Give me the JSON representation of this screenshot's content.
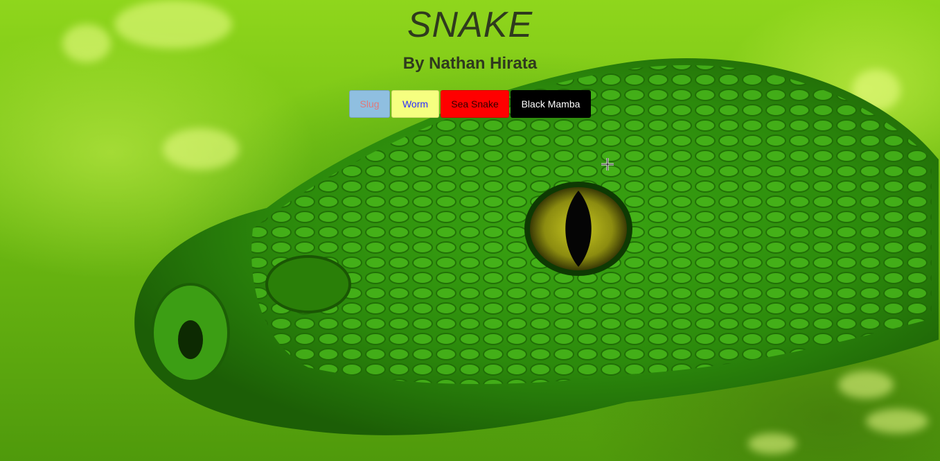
{
  "header": {
    "title": "SNAKE",
    "subtitle": "By Nathan Hirata"
  },
  "buttons": [
    {
      "label": "Slug",
      "bg": "#8fbfe0",
      "fg": "#e07a7a"
    },
    {
      "label": "Worm",
      "bg": "#f6ff80",
      "fg": "#2a2aff"
    },
    {
      "label": "Sea Snake",
      "bg": "#ff0000",
      "fg": "#330000"
    },
    {
      "label": "Black Mamba",
      "bg": "#000000",
      "fg": "#ffffff"
    }
  ],
  "background": {
    "subject": "green-snake-closeup",
    "palette": [
      "#8fd61c",
      "#3f9a12",
      "#e6e600"
    ]
  },
  "cursor": {
    "type": "crosshair-icon"
  }
}
